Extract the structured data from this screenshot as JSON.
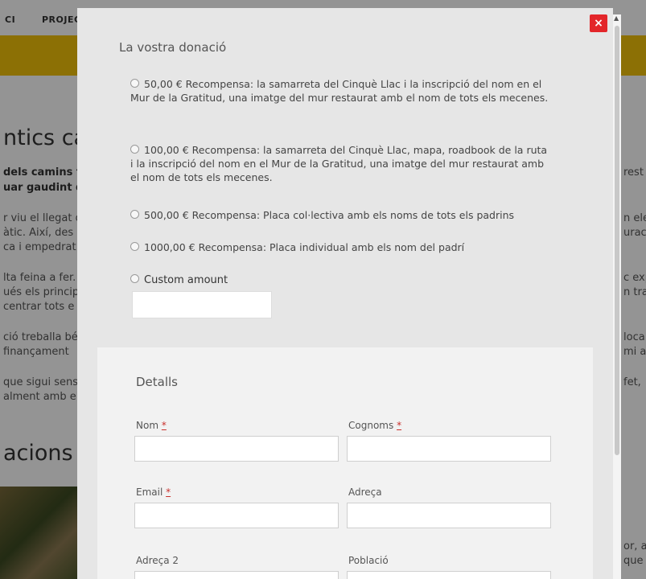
{
  "background": {
    "nav": [
      "CI",
      "PROJEC"
    ],
    "heading_1": "ntics ca",
    "heading_2": "acions p",
    "left_lines": [
      "dels camins t",
      "uar gaudint de",
      "r viu el llegat d",
      "àtic. Així, des d",
      "ca i empedrat",
      "lta feina a fer.",
      "ués els princip",
      "centrar tots e",
      "ció treballa bé",
      "finançament",
      "que sigui sens",
      "alment amb el"
    ],
    "right_lines": [
      "rest",
      "n ele",
      "urac",
      "c exp",
      "n tra",
      "loca",
      "mi a",
      "fet,",
      "or, a",
      "que"
    ]
  },
  "modal": {
    "close_label": "×",
    "donation_title": "La vostra donació",
    "options": [
      "50,00 € Recompensa: la samarreta del Cinquè Llac i la inscripció del nom en el Mur de la Gratitud, una imatge del mur restaurat amb el nom de tots els mecenes.",
      "100,00 € Recompensa: la samarreta del Cinquè Llac, mapa, roadbook de la ruta i la inscripció del nom en el Mur de la Gratitud, una imatge del mur restaurat amb el nom de tots els mecenes.",
      "500,00 € Recompensa: Placa col·lectiva amb els noms de tots els padrins",
      "1000,00 € Recompensa: Placa individual amb els nom del padrí",
      "Custom amount"
    ],
    "custom_amount_value": "",
    "details": {
      "title": "Detalls",
      "required_mark": "*",
      "fields": {
        "nom": "Nom",
        "cognoms": "Cognoms",
        "email": "Email",
        "adreca": "Adreça",
        "adreca2": "Adreça 2",
        "poblacio": "Població"
      }
    }
  }
}
